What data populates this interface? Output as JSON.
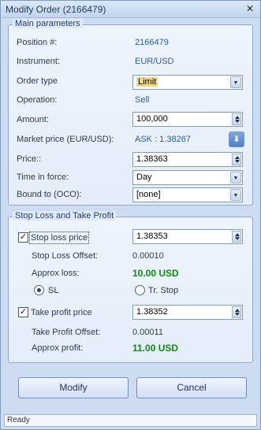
{
  "window": {
    "title": "Modify Order (2166479)",
    "close_glyph": "✕"
  },
  "main": {
    "legend": "Main parameters",
    "position_label": "Position #:",
    "position_value": "2166479",
    "instrument_label": "Instrument:",
    "instrument_value": "EUR/USD",
    "order_type_label": "Order type",
    "order_type_value": "Limit",
    "operation_label": "Operation:",
    "operation_value": "Sell",
    "amount_label": "Amount:",
    "amount_value": "100,000",
    "market_label": "Market price (EUR/USD):",
    "market_value": "ASK : 1.38267",
    "price_label": "Price::",
    "price_value": "1.38363",
    "tif_label": "Time in force:",
    "tif_value": "Day",
    "oco_label": "Bound to (OCO):",
    "oco_value": "[none]"
  },
  "sltp": {
    "legend": "Stop Loss and Take Profit",
    "stop_loss_label": "Stop loss price",
    "stop_loss_checked": true,
    "stop_loss_value": "1.38353",
    "sl_offset_label": "Stop Loss Offset:",
    "sl_offset_value": "0.00010",
    "approx_loss_label": "Approx loss:",
    "approx_loss_value": "10.00 USD",
    "radio_sl_label": "SL",
    "radio_trstop_label": "Tr. Stop",
    "radio_selected": "SL",
    "take_profit_label": "Take profit price",
    "take_profit_checked": true,
    "take_profit_value": "1.38352",
    "tp_offset_label": "Take Profit Offset:",
    "tp_offset_value": "0.00011",
    "approx_profit_label": "Approx profit:",
    "approx_profit_value": "11.00 USD"
  },
  "buttons": {
    "modify": "Modify",
    "cancel": "Cancel"
  },
  "status": {
    "text": "Ready"
  },
  "icons": {
    "dropdown": "chevron-down-icon",
    "spin": "spin-icon",
    "market_arrow": "arrow-down-icon",
    "check": "check-icon",
    "close": "close-icon"
  },
  "glyphs": {
    "dropdown": "▼",
    "market_arrow": "⬇",
    "check": "✓"
  }
}
